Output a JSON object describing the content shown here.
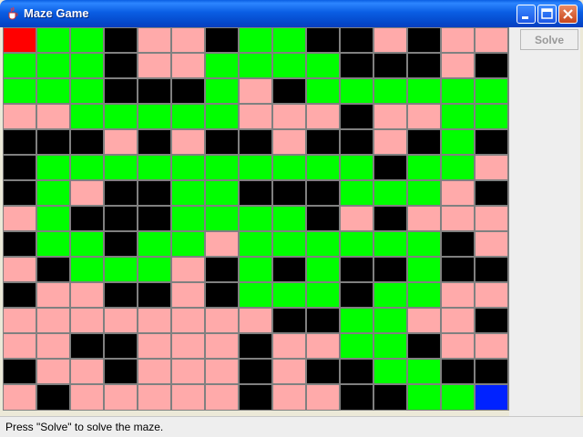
{
  "window": {
    "title": "Maze Game",
    "icon": "java-cup-icon"
  },
  "controls": {
    "solve_label": "Solve",
    "solve_enabled": false
  },
  "status": {
    "text": "Press \"Solve\" to solve the maze."
  },
  "maze": {
    "colors": {
      "S": "#ff0000",
      "E": "#0022ff",
      "G": "#00ff00",
      "P": "#ffaaaa",
      "B": "#000000"
    },
    "legend": {
      "S": "start",
      "E": "end",
      "G": "path",
      "P": "visited",
      "B": "wall"
    },
    "rows": [
      "SGGBPPBGGBBPBPP",
      "GGGBPPGGGGBBBPB",
      "GGGBBBGPBGGGGGG",
      "PPGGGGGPPPBPPGG",
      "BBBPBPBBPBBPBGB",
      "BGGGGGGGGGGBGGP",
      "BGPBBGGBBBGGGPB",
      "PGBBBGGGGBPBPPP",
      "BGGBGGPGGGGGGBP",
      "PBGGGPBGBGBBGBB",
      "BPPBBPBGGGBGGPP",
      "PPPPPPPPBBGGPPB",
      "PPBBPPPBPPGGBPP",
      "BPPBPPPBPBBGGBB",
      "PBPPPPPBPPBBGGE"
    ]
  }
}
